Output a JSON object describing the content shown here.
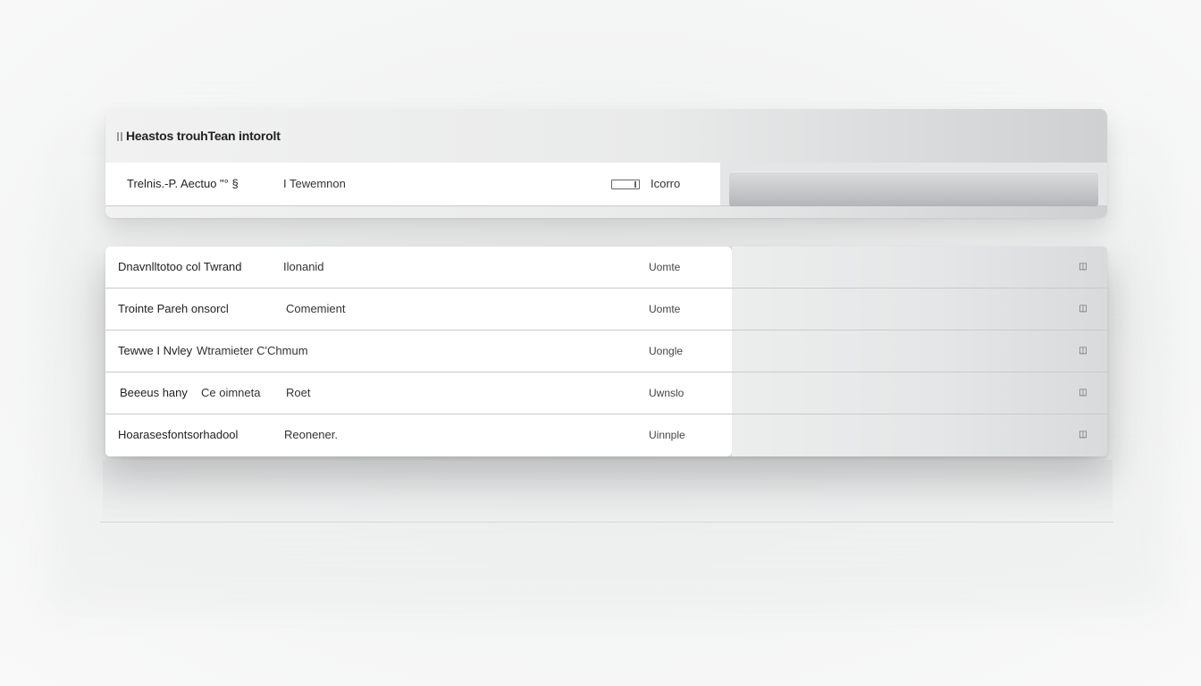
{
  "panel": {
    "title": "Heastos trouhTean intorolt",
    "title_icon": "grip-icon"
  },
  "header": {
    "col1": "Trelnis.-P. Aectuo \"° §",
    "col2": "I Tewemnon",
    "col3_icon": "toggle-icon",
    "col3": "Icorro"
  },
  "rows": [
    {
      "name": "Dnavnlltotoo col  Twrand",
      "kind": "Ilonanid",
      "type": "Uomte",
      "icon": "row-action-icon"
    },
    {
      "name": "Trointe  Pareh onsorcl",
      "kind": "Comemient",
      "type": "Uomte",
      "icon": "row-action-icon"
    },
    {
      "name": "Tewwe I Nvley",
      "kind": "Wtramieter  C'Chmum",
      "type": "Uongle",
      "icon": "row-action-icon"
    },
    {
      "name": "Beeeus  hany",
      "kind": "Ce oimneta",
      "kind2": "Roet",
      "type": "Uwnslo",
      "icon": "row-action-icon"
    },
    {
      "name": "Hoarasesfontsorhadool",
      "kind": "Reonener.",
      "type": "Uinnple",
      "icon": "row-action-icon"
    }
  ]
}
